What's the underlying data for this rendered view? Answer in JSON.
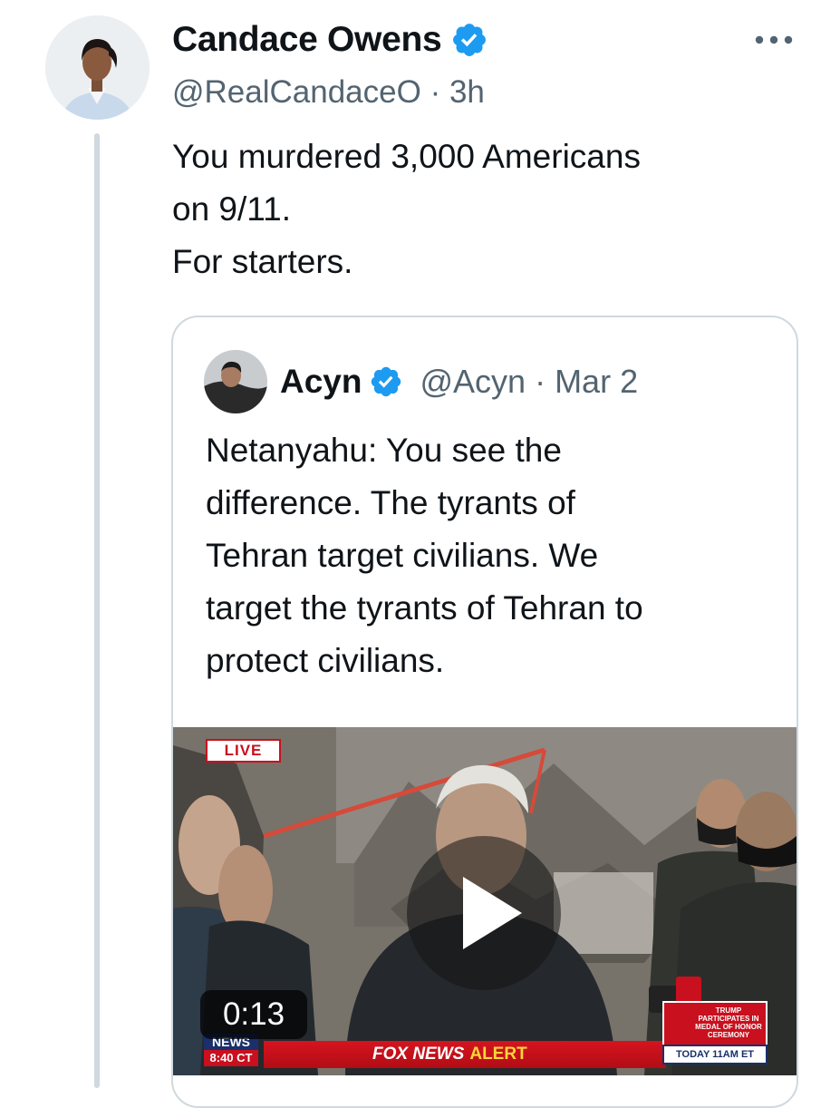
{
  "author": {
    "name": "Candace Owens",
    "handle": "@RealCandaceO",
    "time": "3h",
    "verified": true,
    "verified_color": "#1d9bf0"
  },
  "tweet": {
    "lines": [
      "You murdered 3,000 Americans",
      "on 9/11.",
      "For starters."
    ]
  },
  "quoted": {
    "name": "Acyn",
    "handle": "@Acyn",
    "date": "Mar 2",
    "lines": [
      "Netanyahu: You see the",
      "difference. The tyrants of",
      "Tehran target civilians. We",
      "target the tyrants of Tehran to",
      "protect civilians."
    ],
    "video": {
      "duration": "0:13",
      "live_badge": "LIVE",
      "network_logo": "NEWS",
      "clock": "8:40 CT",
      "alert_brand": "FOX NEWS",
      "alert_word": "ALERT",
      "promo_text": "TRUMP PARTICIPATES IN MEDAL OF HONOR CEREMONY",
      "promo_time": "TODAY 11AM ET"
    }
  },
  "icons": {
    "verified": "verified-badge-icon",
    "more": "more-dots-icon",
    "play": "play-icon"
  }
}
